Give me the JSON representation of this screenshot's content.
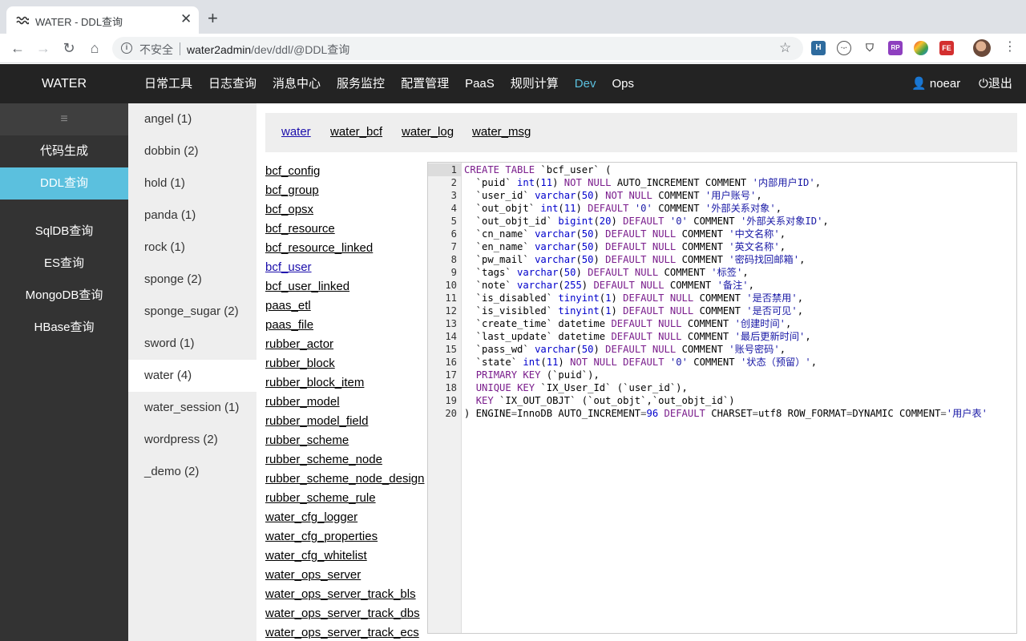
{
  "browser": {
    "tab_title": "WATER - DDL查询",
    "new_tab_glyph": "+",
    "close_glyph": "✕",
    "security_label": "不安全",
    "url_host": "water2admin",
    "url_path": "/dev/ddl/@DDL查询",
    "extensions": [
      "ext-h-icon",
      "ext-clock-icon",
      "ext-shield-icon",
      "ext-rp-icon",
      "ext-color-icon",
      "ext-fe-icon"
    ]
  },
  "header": {
    "brand": "WATER",
    "nav": [
      "日常工具",
      "日志查询",
      "消息中心",
      "服务监控",
      "配置管理",
      "PaaS",
      "规则计算",
      "Dev",
      "Ops"
    ],
    "active_nav": "Dev",
    "user": "noear",
    "logout": "退出"
  },
  "sidebar": {
    "toggle_glyph": "≡",
    "items": [
      "代码生成",
      "DDL查询",
      "SqlDB查询",
      "ES查询",
      "MongoDB查询",
      "HBase查询"
    ],
    "active": "DDL查询"
  },
  "schemas": {
    "items": [
      "angel (1)",
      "dobbin (2)",
      "hold (1)",
      "panda (1)",
      "rock (1)",
      "sponge (2)",
      "sponge_sugar (2)",
      "sword (1)",
      "water (4)",
      "water_session (1)",
      "wordpress (2)",
      "_demo (2)"
    ],
    "active": "water (4)"
  },
  "db_tabs": {
    "items": [
      "water",
      "water_bcf",
      "water_log",
      "water_msg"
    ],
    "active": "water"
  },
  "tables": {
    "items": [
      "bcf_config",
      "bcf_group",
      "bcf_opsx",
      "bcf_resource",
      "bcf_resource_linked",
      "bcf_user",
      "bcf_user_linked",
      "paas_etl",
      "paas_file",
      "rubber_actor",
      "rubber_block",
      "rubber_block_item",
      "rubber_model",
      "rubber_model_field",
      "rubber_scheme",
      "rubber_scheme_node",
      "rubber_scheme_node_design",
      "rubber_scheme_rule",
      "water_cfg_logger",
      "water_cfg_properties",
      "water_cfg_whitelist",
      "water_ops_server",
      "water_ops_server_track_bls",
      "water_ops_server_track_dbs",
      "water_ops_server_track_ecs"
    ],
    "active": "bcf_user"
  },
  "ddl": {
    "lines": [
      "CREATE TABLE `bcf_user` (",
      "  `puid` int(11) NOT NULL AUTO_INCREMENT COMMENT '内部用户ID',",
      "  `user_id` varchar(50) NOT NULL COMMENT '用户账号',",
      "  `out_objt` int(11) DEFAULT '0' COMMENT '外部关系对象',",
      "  `out_objt_id` bigint(20) DEFAULT '0' COMMENT '外部关系对象ID',",
      "  `cn_name` varchar(50) DEFAULT NULL COMMENT '中文名称',",
      "  `en_name` varchar(50) DEFAULT NULL COMMENT '英文名称',",
      "  `pw_mail` varchar(50) DEFAULT NULL COMMENT '密码找回邮箱',",
      "  `tags` varchar(50) DEFAULT NULL COMMENT '标签',",
      "  `note` varchar(255) DEFAULT NULL COMMENT '备注',",
      "  `is_disabled` tinyint(1) DEFAULT NULL COMMENT '是否禁用',",
      "  `is_visibled` tinyint(1) DEFAULT NULL COMMENT '是否可见',",
      "  `create_time` datetime DEFAULT NULL COMMENT '创建时间',",
      "  `last_update` datetime DEFAULT NULL COMMENT '最后更新时间',",
      "  `pass_wd` varchar(50) DEFAULT NULL COMMENT '账号密码',",
      "  `state` int(11) NOT NULL DEFAULT '0' COMMENT '状态（预留）',",
      "  PRIMARY KEY (`puid`),",
      "  UNIQUE KEY `IX_User_Id` (`user_id`),",
      "  KEY `IX_OUT_OBJT` (`out_objt`,`out_objt_id`)",
      ") ENGINE=InnoDB AUTO_INCREMENT=96 DEFAULT CHARSET=utf8 ROW_FORMAT=DYNAMIC COMMENT='用户表'"
    ]
  }
}
